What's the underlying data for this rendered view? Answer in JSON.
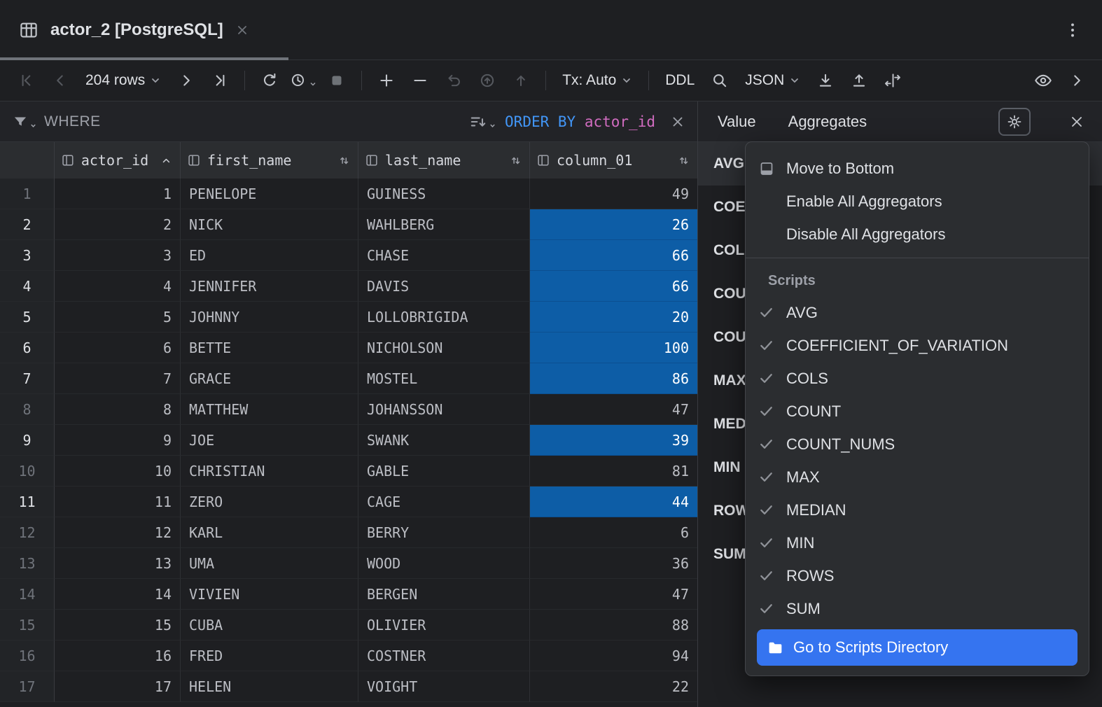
{
  "colors": {
    "selection_blue": "#0d5da6",
    "menu_accent_blue": "#3574f0",
    "keyword_blue": "#4296f7",
    "identifier_pink": "#d16cc0"
  },
  "tab": {
    "title": "actor_2 [PostgreSQL]"
  },
  "toolbar": {
    "rows": "204 rows",
    "tx": "Tx: Auto",
    "ddl": "DDL",
    "json": "JSON"
  },
  "filter": {
    "where": "WHERE",
    "order_keyword": "ORDER BY",
    "order_column": "actor_id"
  },
  "grid": {
    "columns": [
      {
        "label": "actor_id",
        "sort": "asc"
      },
      {
        "label": "first_name",
        "sort": "none"
      },
      {
        "label": "last_name",
        "sort": "none"
      },
      {
        "label": "column_01",
        "sort": "none"
      }
    ],
    "rows": [
      {
        "n": "1",
        "actor_id": "1",
        "first_name": "PENELOPE",
        "last_name": "GUINESS",
        "column_01": "49",
        "selected": false
      },
      {
        "n": "2",
        "actor_id": "2",
        "first_name": "NICK",
        "last_name": "WAHLBERG",
        "column_01": "26",
        "selected": true
      },
      {
        "n": "3",
        "actor_id": "3",
        "first_name": "ED",
        "last_name": "CHASE",
        "column_01": "66",
        "selected": true
      },
      {
        "n": "4",
        "actor_id": "4",
        "first_name": "JENNIFER",
        "last_name": "DAVIS",
        "column_01": "66",
        "selected": true
      },
      {
        "n": "5",
        "actor_id": "5",
        "first_name": "JOHNNY",
        "last_name": "LOLLOBRIGIDA",
        "column_01": "20",
        "selected": true
      },
      {
        "n": "6",
        "actor_id": "6",
        "first_name": "BETTE",
        "last_name": "NICHOLSON",
        "column_01": "100",
        "selected": true
      },
      {
        "n": "7",
        "actor_id": "7",
        "first_name": "GRACE",
        "last_name": "MOSTEL",
        "column_01": "86",
        "selected": true
      },
      {
        "n": "8",
        "actor_id": "8",
        "first_name": "MATTHEW",
        "last_name": "JOHANSSON",
        "column_01": "47",
        "selected": false
      },
      {
        "n": "9",
        "actor_id": "9",
        "first_name": "JOE",
        "last_name": "SWANK",
        "column_01": "39",
        "selected": true
      },
      {
        "n": "10",
        "actor_id": "10",
        "first_name": "CHRISTIAN",
        "last_name": "GABLE",
        "column_01": "81",
        "selected": false
      },
      {
        "n": "11",
        "actor_id": "11",
        "first_name": "ZERO",
        "last_name": "CAGE",
        "column_01": "44",
        "selected": true
      },
      {
        "n": "12",
        "actor_id": "12",
        "first_name": "KARL",
        "last_name": "BERRY",
        "column_01": "6",
        "selected": false
      },
      {
        "n": "13",
        "actor_id": "13",
        "first_name": "UMA",
        "last_name": "WOOD",
        "column_01": "36",
        "selected": false
      },
      {
        "n": "14",
        "actor_id": "14",
        "first_name": "VIVIEN",
        "last_name": "BERGEN",
        "column_01": "47",
        "selected": false
      },
      {
        "n": "15",
        "actor_id": "15",
        "first_name": "CUBA",
        "last_name": "OLIVIER",
        "column_01": "88",
        "selected": false
      },
      {
        "n": "16",
        "actor_id": "16",
        "first_name": "FRED",
        "last_name": "COSTNER",
        "column_01": "94",
        "selected": false
      },
      {
        "n": "17",
        "actor_id": "17",
        "first_name": "HELEN",
        "last_name": "VOIGHT",
        "column_01": "22",
        "selected": false
      }
    ]
  },
  "panel": {
    "tabs": [
      "Value",
      "Aggregates"
    ],
    "aggregates": [
      {
        "name": "AVG",
        "selected": true
      },
      {
        "name": "COEFFICIENT_OF_VARIATION",
        "selected": false
      },
      {
        "name": "COLS",
        "selected": false
      },
      {
        "name": "COUNT",
        "selected": false
      },
      {
        "name": "COUNT_NUMS",
        "selected": false
      },
      {
        "name": "MAX",
        "selected": false
      },
      {
        "name": "MEDIAN",
        "selected": false
      },
      {
        "name": "MIN",
        "selected": false
      },
      {
        "name": "ROWS",
        "selected": false
      },
      {
        "name": "SUM",
        "selected": false
      }
    ]
  },
  "menu": {
    "actions": [
      "Move to Bottom",
      "Enable All Aggregators",
      "Disable All Aggregators"
    ],
    "section": "Scripts",
    "scripts": [
      {
        "label": "AVG",
        "checked": true
      },
      {
        "label": "COEFFICIENT_OF_VARIATION",
        "checked": true
      },
      {
        "label": "COLS",
        "checked": true
      },
      {
        "label": "COUNT",
        "checked": true
      },
      {
        "label": "COUNT_NUMS",
        "checked": true
      },
      {
        "label": "MAX",
        "checked": true
      },
      {
        "label": "MEDIAN",
        "checked": true
      },
      {
        "label": "MIN",
        "checked": true
      },
      {
        "label": "ROWS",
        "checked": true
      },
      {
        "label": "SUM",
        "checked": true
      }
    ],
    "footer": "Go to Scripts Directory"
  }
}
